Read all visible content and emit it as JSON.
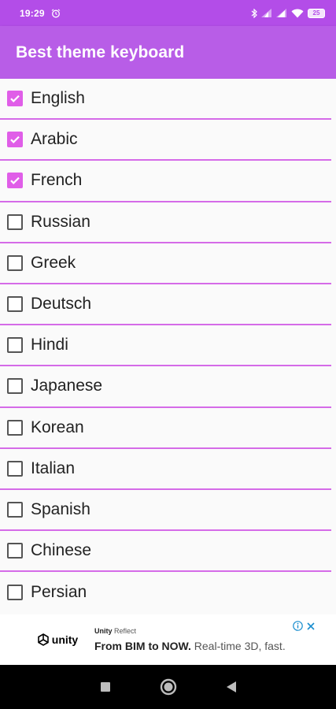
{
  "status_bar": {
    "time": "19:29",
    "battery": "25",
    "icons": [
      "alarm-icon",
      "bluetooth-icon",
      "signal-icon",
      "signal-icon",
      "wifi-icon",
      "battery-icon"
    ]
  },
  "app_bar": {
    "title": "Best theme keyboard",
    "color": "#b85de7"
  },
  "languages": [
    {
      "label": "English",
      "checked": true
    },
    {
      "label": "Arabic",
      "checked": true
    },
    {
      "label": "French",
      "checked": true
    },
    {
      "label": "Russian",
      "checked": false
    },
    {
      "label": "Greek",
      "checked": false
    },
    {
      "label": "Deutsch",
      "checked": false
    },
    {
      "label": "Hindi",
      "checked": false
    },
    {
      "label": "Japanese",
      "checked": false
    },
    {
      "label": "Korean",
      "checked": false
    },
    {
      "label": "Italian",
      "checked": false
    },
    {
      "label": "Spanish",
      "checked": false
    },
    {
      "label": "Chinese",
      "checked": false
    },
    {
      "label": "Persian",
      "checked": false
    }
  ],
  "colors": {
    "accent": "#e05ee8",
    "divider": "#d56be8"
  },
  "ad": {
    "logo_text": "unity",
    "brand_prefix": "Unity",
    "brand_suffix": "Reflect",
    "headline_strong": "From BIM to NOW.",
    "headline_rest": "Real-time 3D, fast.",
    "info_icon": "info-icon",
    "close_icon": "close-icon"
  },
  "nav_bar": {
    "buttons": [
      "recents-button",
      "home-button",
      "back-button"
    ]
  }
}
